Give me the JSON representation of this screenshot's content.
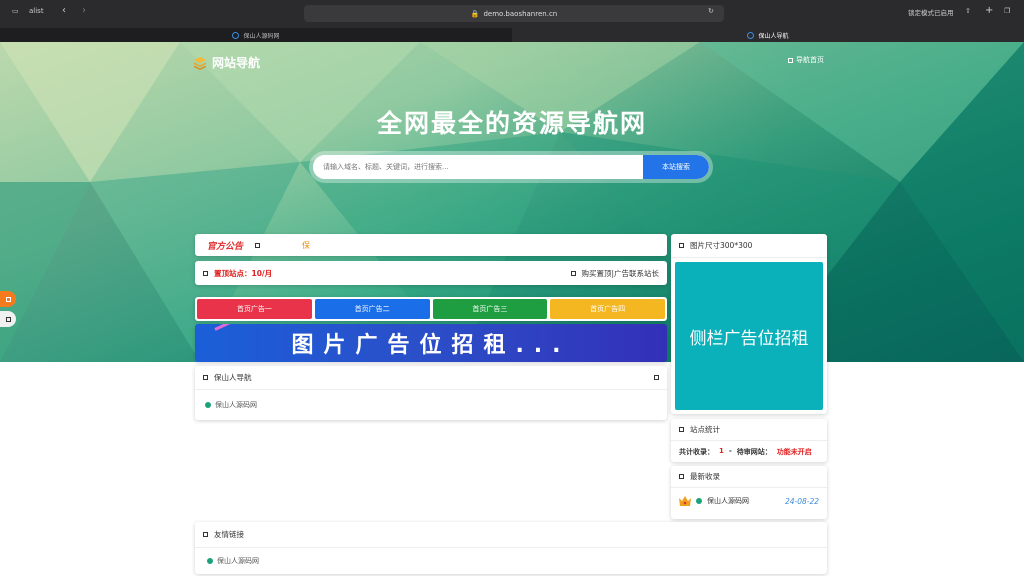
{
  "browser": {
    "profile": "alist",
    "url": "demo.baoshanren.cn",
    "lock_mode": "锁定模式已启用",
    "tabs": [
      {
        "label": "保山人源码网"
      },
      {
        "label": "保山人导航"
      }
    ]
  },
  "header": {
    "logo_text": "网站导航",
    "nav_home": "导航首页"
  },
  "hero": {
    "title": "全网最全的资源导航网",
    "search_placeholder": "请输入域名、标题、关键词，进行搜索...",
    "search_button": "本站搜索"
  },
  "notice": {
    "label": "官方公告",
    "marquee": "保"
  },
  "top_sites": {
    "label": "置顶站点：",
    "value": "10/月",
    "right_text": "购买置顶|广告联系站长"
  },
  "ad_buttons": [
    {
      "label": "首页广告一",
      "color": "#e8334a"
    },
    {
      "label": "首页广告二",
      "color": "#1a6fe8"
    },
    {
      "label": "首页广告三",
      "color": "#1e9e40"
    },
    {
      "label": "首页广告四",
      "color": "#f4b722"
    }
  ],
  "banner": {
    "text": "图片广告位招租..."
  },
  "nav_section": {
    "title": "保山人导航",
    "items": [
      {
        "label": "保山人源码网"
      }
    ]
  },
  "side_ad": {
    "title": "图片尺寸300*300",
    "text": "侧栏广告位招租"
  },
  "stats": {
    "title": "站点统计",
    "total_label": "共计收录：",
    "total_value": "1",
    "sep": "-",
    "pending_label": "待审网站：",
    "pending_value": "功能未开启"
  },
  "latest": {
    "title": "最新收录",
    "items": [
      {
        "label": "保山人源码网",
        "date": "24-08-22"
      }
    ]
  },
  "friends": {
    "title": "友情链接",
    "items": [
      {
        "label": "保山人源码网"
      }
    ]
  }
}
